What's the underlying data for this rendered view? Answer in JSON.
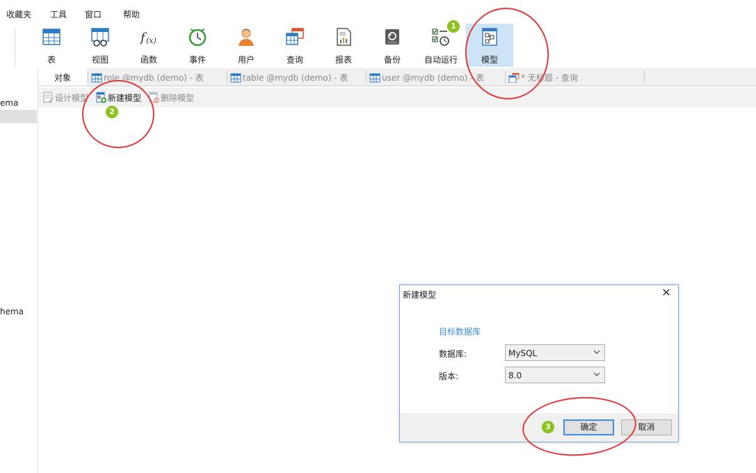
{
  "menu": {
    "items": [
      "收藏夹",
      "工具",
      "窗口",
      "帮助"
    ]
  },
  "ribbon": {
    "buttons": [
      {
        "label": "表",
        "icon": "table-icon"
      },
      {
        "label": "视图",
        "icon": "view-icon"
      },
      {
        "label": "函数",
        "icon": "function-icon"
      },
      {
        "label": "事件",
        "icon": "event-clock-icon"
      },
      {
        "label": "用户",
        "icon": "user-icon"
      },
      {
        "label": "查询",
        "icon": "query-icon"
      },
      {
        "label": "报表",
        "icon": "report-icon"
      },
      {
        "label": "备份",
        "icon": "backup-icon"
      },
      {
        "label": "自动运行",
        "icon": "auto-run-icon"
      },
      {
        "label": "模型",
        "icon": "model-icon"
      }
    ],
    "active": "模型"
  },
  "tabs": [
    {
      "label": "对象"
    },
    {
      "label": "role @mydb (demo) - 表"
    },
    {
      "label": "table @mydb (demo) - 表"
    },
    {
      "label": "user @mydb (demo) - 表"
    },
    {
      "label": "* 无标题 - 查询"
    }
  ],
  "toolbar": {
    "design": "设计模型",
    "new": "新建模型",
    "delete": "删除模型"
  },
  "sidebar": {
    "item1": "ema",
    "item2": "hema"
  },
  "dialog": {
    "title": "新建模型",
    "close": "✕",
    "section": "目标数据库",
    "db_label": "数据库:",
    "db_value": "MySQL",
    "version_label": "版本:",
    "version_value": "8.0",
    "ok": "确定",
    "cancel": "取消"
  },
  "annotations": {
    "badge1": "1",
    "badge2": "2",
    "badge3": "3",
    "ring_color": "#e23a3a",
    "badge_color": "#8cc320"
  },
  "colors": {
    "accent": "#3a8fd8",
    "active_ribbon": "#cde4f7"
  }
}
